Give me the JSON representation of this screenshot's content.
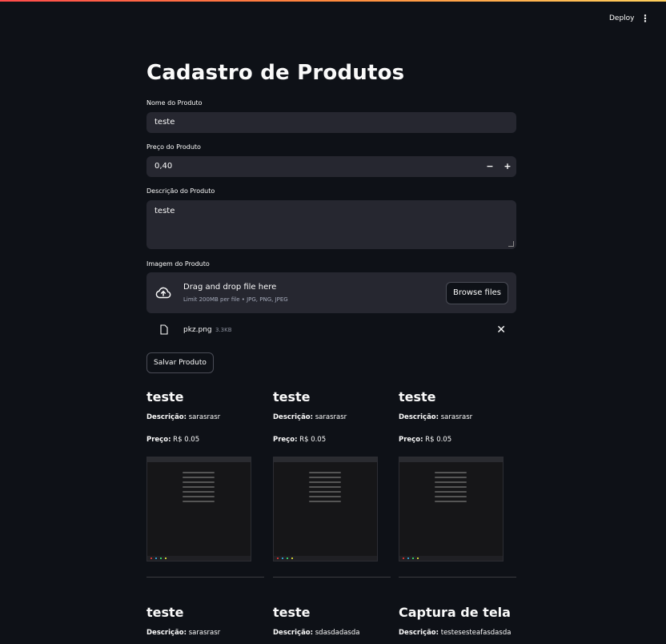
{
  "header": {
    "deploy_label": "Deploy",
    "menu_icon": "kebab-menu-icon"
  },
  "page": {
    "title": "Cadastro de Produtos"
  },
  "form": {
    "name_label": "Nome do Produto",
    "name_value": "teste",
    "price_label": "Preço do Produto",
    "price_value": "0,40",
    "decrement": "−",
    "increment": "+",
    "description_label": "Descrição do Produto",
    "description_value": "teste",
    "image_label": "Imagem do Produto",
    "uploader": {
      "title": "Drag and drop file here",
      "hint": "Limit 200MB per file • JPG, PNG, JPEG",
      "browse_label": "Browse files"
    },
    "uploaded_file": {
      "name": "pkz.png",
      "size": "3.3KB"
    },
    "save_label": "Salvar Produto"
  },
  "products": [
    {
      "name": "teste",
      "desc_label": "Descrição:",
      "description": "sarasrasr",
      "price_label": "Preço:",
      "price": "R$ 0.05"
    },
    {
      "name": "teste",
      "desc_label": "Descrição:",
      "description": "sarasrasr",
      "price_label": "Preço:",
      "price": "R$ 0.05"
    },
    {
      "name": "teste",
      "desc_label": "Descrição:",
      "description": "sarasrasr",
      "price_label": "Preço:",
      "price": "R$ 0.05"
    },
    {
      "name": "teste",
      "desc_label": "Descrição:",
      "description": "sarasrasr",
      "price_label": "",
      "price": ""
    },
    {
      "name": "teste",
      "desc_label": "Descrição:",
      "description": "sdasdadasda",
      "price_label": "",
      "price": ""
    },
    {
      "name": "Captura de tela",
      "desc_label": "Descrição:",
      "description": "testesesteafasdasda",
      "price_label": "",
      "price": ""
    }
  ],
  "colors": {
    "background": "#0e1117",
    "input_bg": "#262730",
    "accent_gradient": [
      "#ff4b4b",
      "#ffd05c"
    ]
  }
}
